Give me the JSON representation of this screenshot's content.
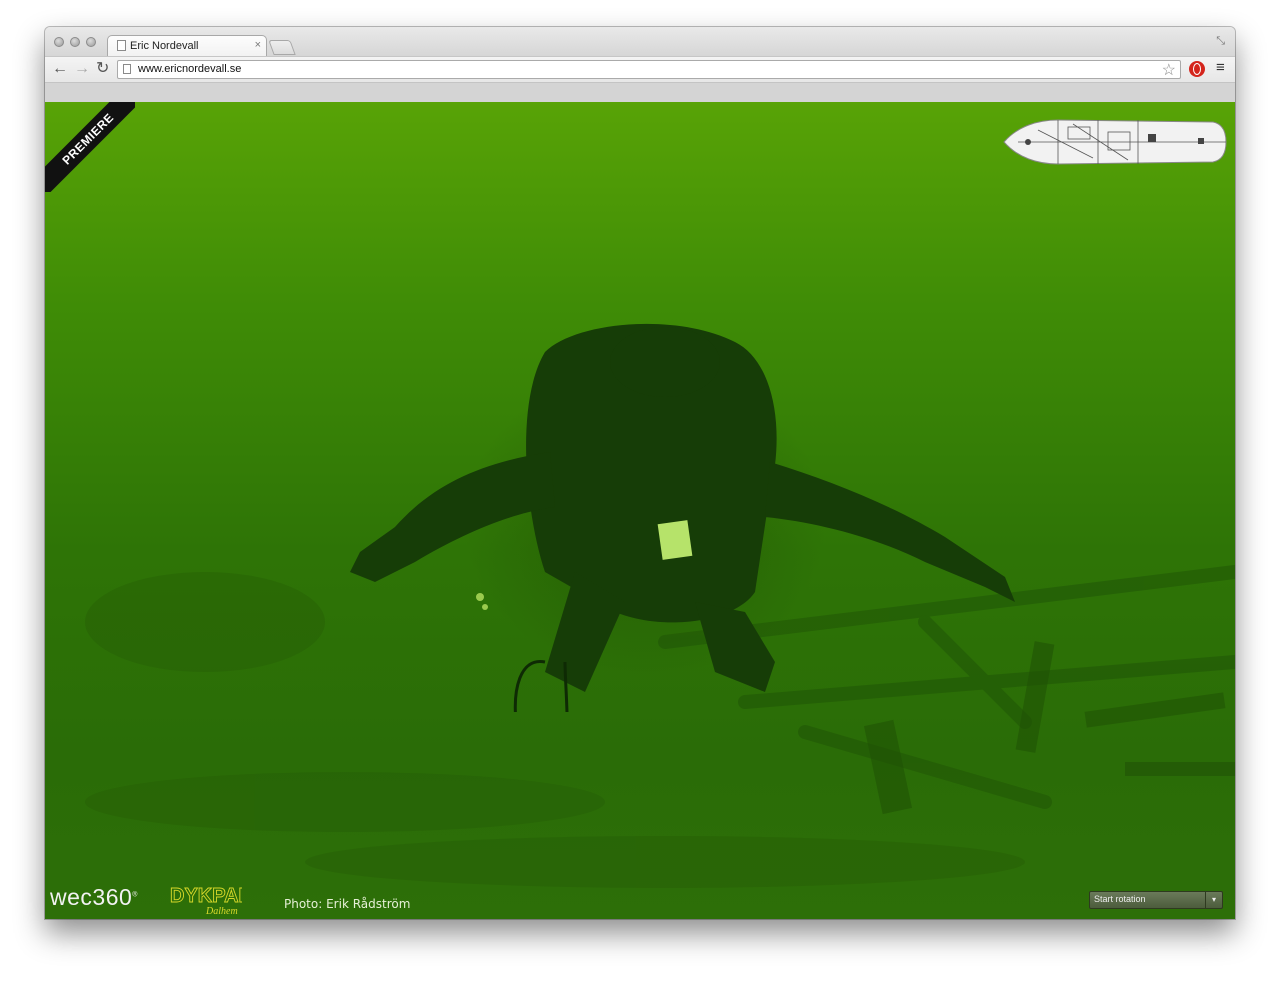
{
  "browser": {
    "tab_title": "Eric Nordevall",
    "tab_close": "×",
    "url": "www.ericnordevall.se",
    "icons": [
      "back-icon",
      "forward-icon",
      "reload-icon",
      "star-icon",
      "opera-extension-icon",
      "menu-icon",
      "restore-icon",
      "page-icon"
    ]
  },
  "page": {
    "ribbon": "PREMIERE",
    "brand_wec": "wec360",
    "brand_wec_mark": "®",
    "brand_dyk": "DYKPARK",
    "brand_dyk_sub": "Dalhem",
    "photo_credit": "Photo: Erik Rådström",
    "rotation_select": {
      "selected": "Start rotation",
      "arrow": "▾"
    },
    "colors": {
      "water_top": "#58a306",
      "water_bottom": "#2d6f08",
      "ribbon": "#111111"
    }
  }
}
